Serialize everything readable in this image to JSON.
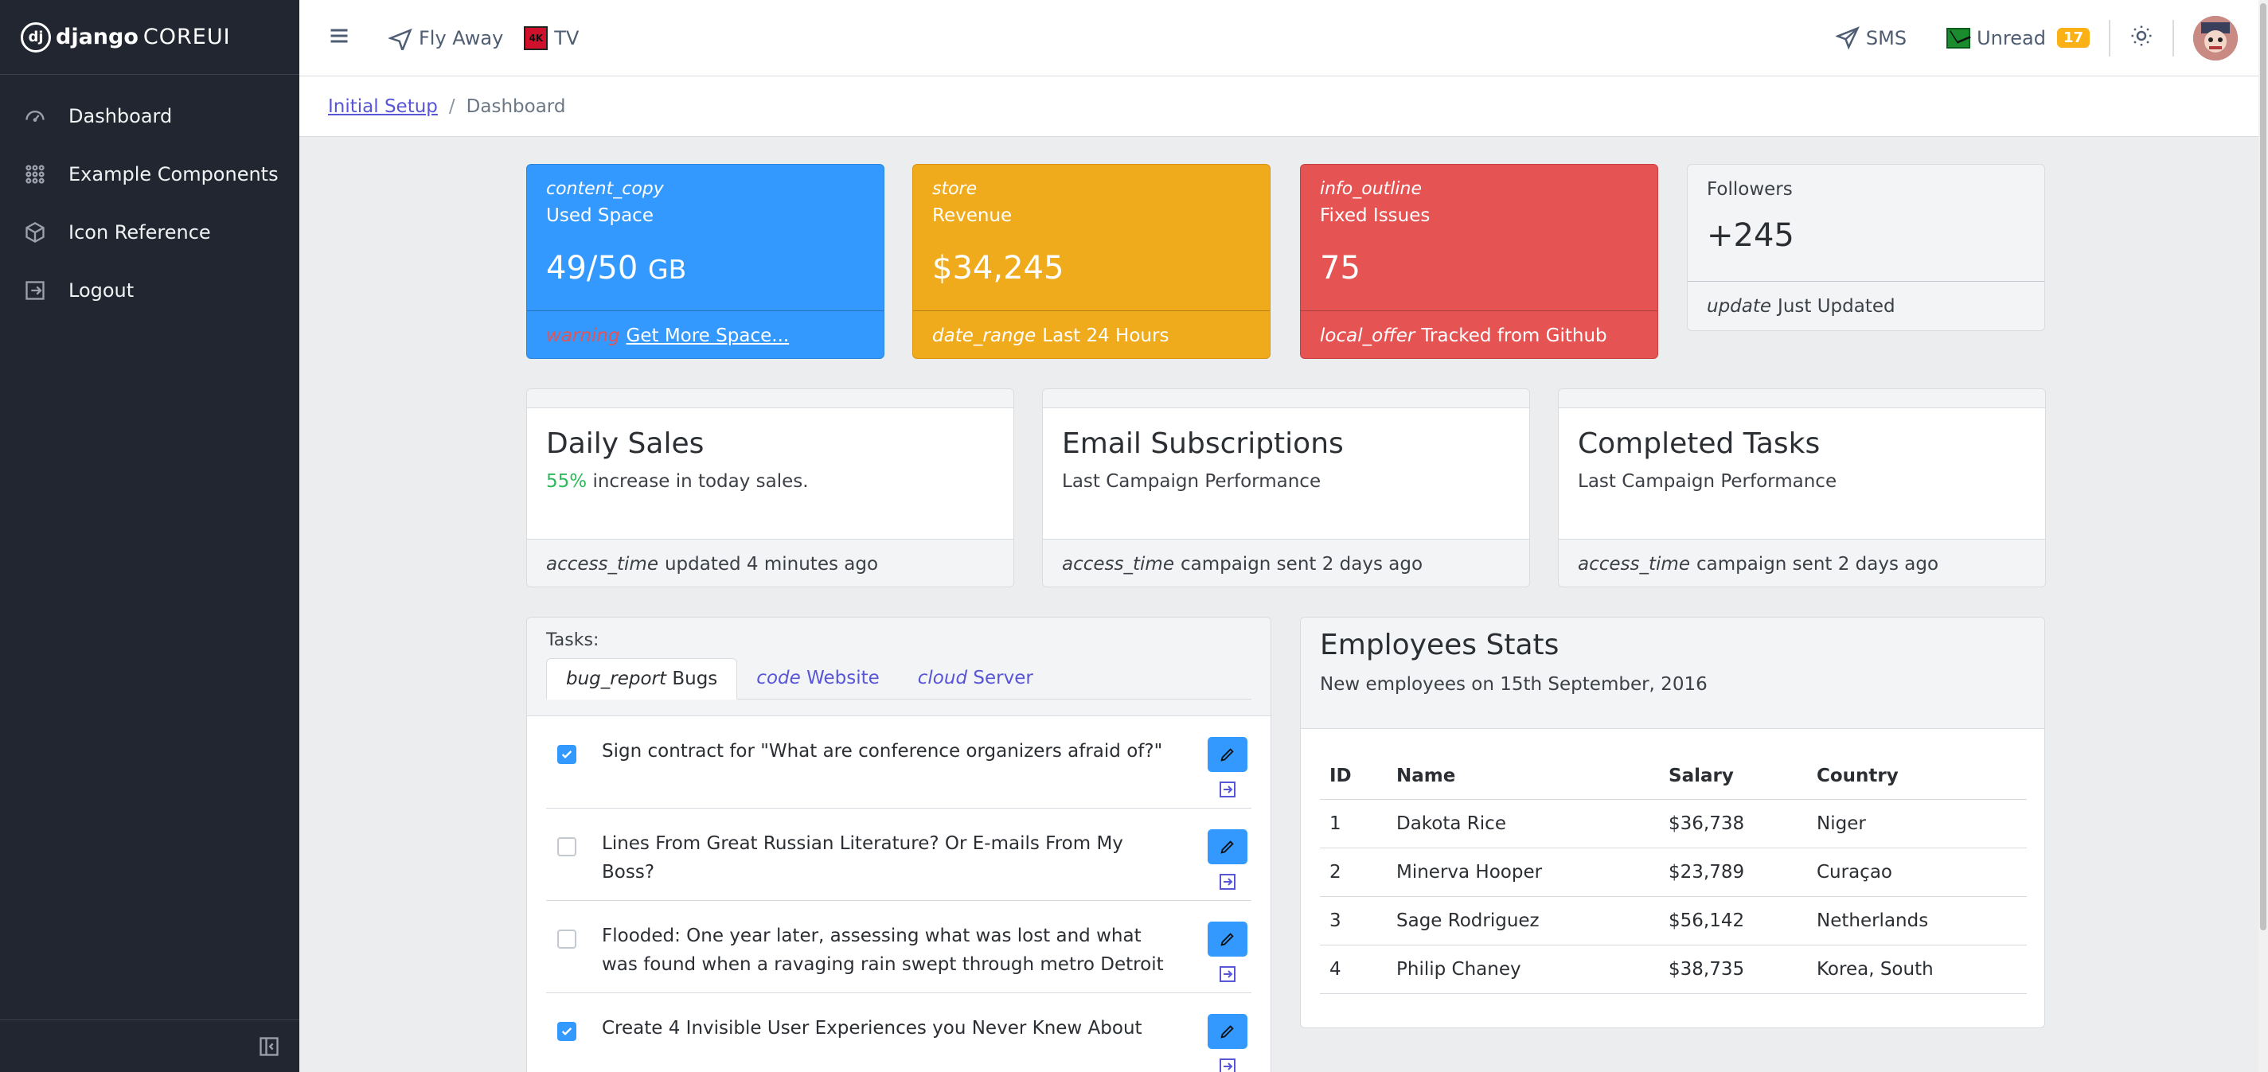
{
  "brand": {
    "name": "django",
    "suffix": "COREUI",
    "mark": "dj"
  },
  "sidebar": {
    "items": [
      {
        "label": "Dashboard",
        "icon": "speedometer-icon"
      },
      {
        "label": "Example Components",
        "icon": "grid-icon"
      },
      {
        "label": "Icon Reference",
        "icon": "cube-icon"
      },
      {
        "label": "Logout",
        "icon": "logout-icon"
      }
    ]
  },
  "header": {
    "links": [
      {
        "label": "Fly Away",
        "icon": "airplane-icon"
      },
      {
        "label": "TV",
        "icon": "tv-4k-icon",
        "badge": "4K"
      }
    ],
    "sms_label": "SMS",
    "unread_label": "Unread",
    "unread_count": "17"
  },
  "breadcrumb": {
    "parent": "Initial Setup",
    "separator": "/",
    "current": "Dashboard"
  },
  "widgets": [
    {
      "icon": "content_copy",
      "label": "Used Space",
      "value": "49/50",
      "unit": "GB",
      "footer_icon": "warning",
      "footer_text": "Get More Space...",
      "color": "#3399ff"
    },
    {
      "icon": "store",
      "label": "Revenue",
      "value": "$34,245",
      "footer_icon": "date_range",
      "footer_text": "Last 24 Hours",
      "color": "#f0ab1c"
    },
    {
      "icon": "info_outline",
      "label": "Fixed Issues",
      "value": "75",
      "footer_icon": "local_offer",
      "footer_text": "Tracked from Github",
      "color": "#e55353"
    }
  ],
  "followers": {
    "label": "Followers",
    "value": "+245",
    "footer_icon": "update",
    "footer_text": "Just Updated"
  },
  "stats": [
    {
      "title": "Daily Sales",
      "highlight": "55%",
      "subtitle": "increase in today sales.",
      "footer_icon": "access_time",
      "footer_text": "updated 4 minutes ago"
    },
    {
      "title": "Email Subscriptions",
      "subtitle": "Last Campaign Performance",
      "footer_icon": "access_time",
      "footer_text": "campaign sent 2 days ago"
    },
    {
      "title": "Completed Tasks",
      "subtitle": "Last Campaign Performance",
      "footer_icon": "access_time",
      "footer_text": "campaign sent 2 days ago"
    }
  ],
  "tasks": {
    "title": "Tasks:",
    "tabs": [
      {
        "icon": "bug_report",
        "label": "Bugs"
      },
      {
        "icon": "code",
        "label": "Website"
      },
      {
        "icon": "cloud",
        "label": "Server"
      }
    ],
    "items": [
      {
        "text": "Sign contract for \"What are conference organizers afraid of?\"",
        "checked": true
      },
      {
        "text": "Lines From Great Russian Literature? Or E-mails From My Boss?",
        "checked": false
      },
      {
        "text": "Flooded: One year later, assessing what was lost and what was found when a ravaging rain swept through metro Detroit",
        "checked": false
      },
      {
        "text": "Create 4 Invisible User Experiences you Never Knew About",
        "checked": true
      }
    ]
  },
  "employees": {
    "title": "Employees Stats",
    "subtitle": "New employees on 15th September, 2016",
    "columns": [
      "ID",
      "Name",
      "Salary",
      "Country"
    ],
    "rows": [
      [
        "1",
        "Dakota Rice",
        "$36,738",
        "Niger"
      ],
      [
        "2",
        "Minerva Hooper",
        "$23,789",
        "Curaçao"
      ],
      [
        "3",
        "Sage Rodriguez",
        "$56,142",
        "Netherlands"
      ],
      [
        "4",
        "Philip Chaney",
        "$38,735",
        "Korea, South"
      ]
    ]
  }
}
